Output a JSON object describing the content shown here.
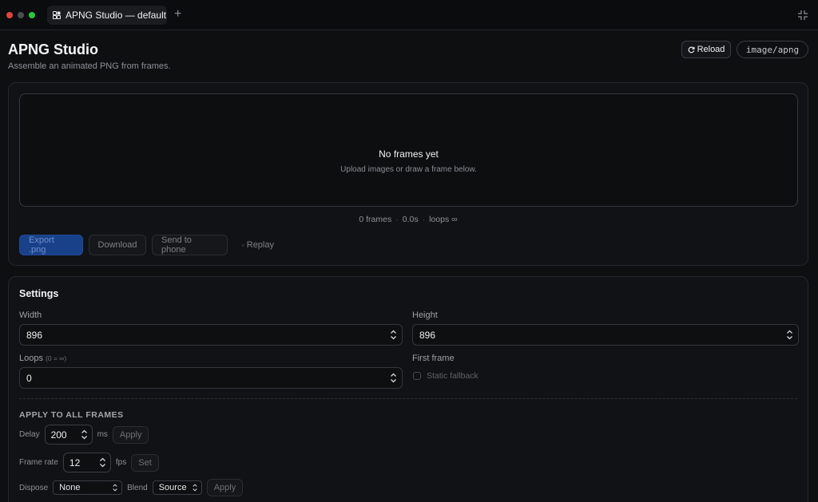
{
  "window": {
    "tab_title": "APNG Studio — default",
    "new_tab_symbol": "+"
  },
  "header": {
    "title": "APNG Studio",
    "subtitle": "Assemble an animated PNG from frames.",
    "reload_label": "Reload",
    "mime_badge": "image/apng"
  },
  "preview": {
    "empty_title": "No frames yet",
    "empty_hint": "Upload images or draw a frame below.",
    "stats": {
      "frames": "0 frames",
      "duration": "0.0s",
      "loops": "loops ∞"
    },
    "actions": {
      "export_label": "Export .png",
      "download_label": "Download",
      "send_label": "Send to phone",
      "replay_label": "Replay"
    }
  },
  "settings": {
    "title": "Settings",
    "width": {
      "label": "Width",
      "value": "896"
    },
    "height": {
      "label": "Height",
      "value": "896"
    },
    "loops": {
      "label": "Loops",
      "hint": "(0 = ∞)",
      "value": "0"
    },
    "first_frame": {
      "label": "First frame",
      "checkbox_label": "Static fallback",
      "checked": false
    },
    "apply_all": {
      "title": "APPLY TO ALL FRAMES",
      "delay": {
        "label": "Delay",
        "value": "200",
        "unit": "ms",
        "button": "Apply"
      },
      "frame_rate": {
        "label": "Frame rate",
        "value": "12",
        "unit": "fps",
        "button": "Set"
      },
      "dispose": {
        "label": "Dispose",
        "value": "None"
      },
      "blend": {
        "label": "Blend",
        "value": "Source"
      },
      "apply_button": "Apply"
    }
  },
  "colors": {
    "background": "#0e0f11",
    "primary_button": "#19418a",
    "close_dot": "#e0443e",
    "max_dot": "#27c93f"
  }
}
